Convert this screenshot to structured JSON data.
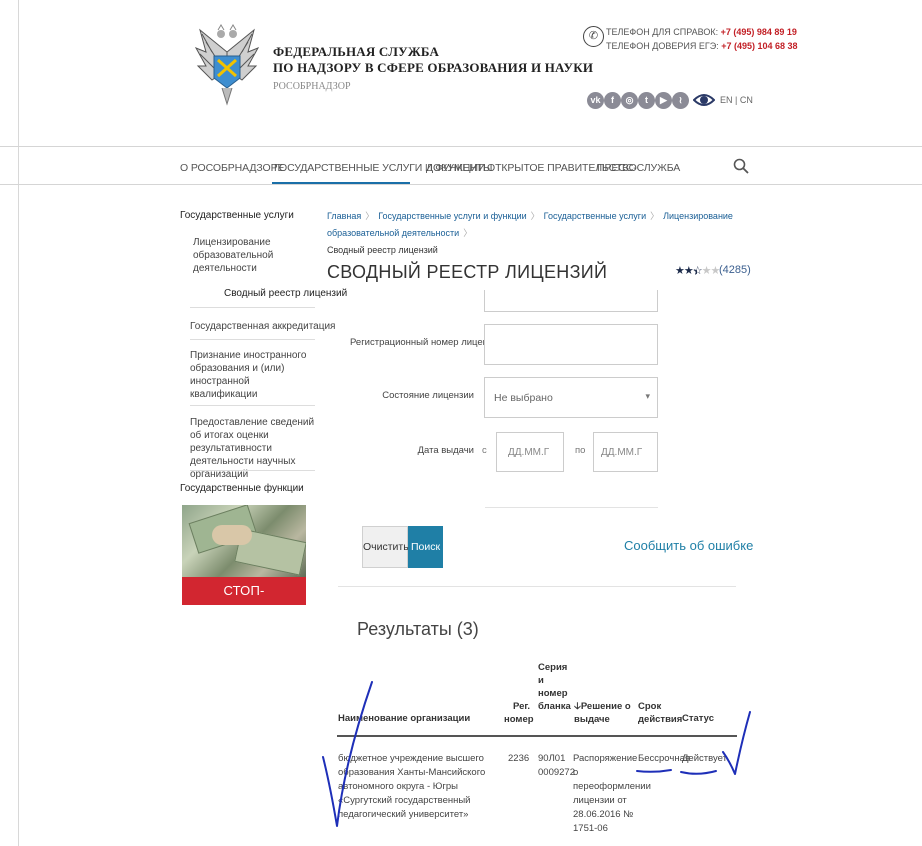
{
  "header": {
    "org_line1": "ФЕДЕРАЛЬНАЯ СЛУЖБА",
    "org_line2": "ПО НАДЗОРУ В СФЕРЕ ОБРАЗОВАНИЯ И НАУКИ",
    "org_short": "РОСОБРНАДЗОР",
    "phone_label": "ТЕЛЕФОН ДЛЯ СПРАВОК:",
    "phone_number": "+7 (495) 984 89 19",
    "trust_label": "ТЕЛЕФОН ДОВЕРИЯ ЕГЭ:",
    "trust_number": "+7 (495) 104 68 38",
    "social_icons": [
      "vk-icon",
      "facebook-icon",
      "instagram-icon",
      "twitter-icon",
      "youtube-icon",
      "rss-icon"
    ],
    "lang_switch": "EN | CN"
  },
  "nav": {
    "items": [
      "О РОСОБРНАДЗОРЕ",
      "ГОСУДАРСТВЕННЫЕ УСЛУГИ И ФУНКЦИИ",
      "ДОКУМЕНТЫ",
      "ОТКРЫТОЕ ПРАВИТЕЛЬСТВО",
      "ПРЕСС-СЛУЖБА"
    ]
  },
  "sidebar": {
    "head1": "Государственные услуги",
    "items": [
      "Лицензирование образовательной деятельности",
      "Сводный реестр лицензий",
      "Государственная аккредитация",
      "Признание иностранного образования и (или) иностранной квалификации",
      "Предоставление сведений об итогах оценки результативности деятельности научных организаций"
    ],
    "head2": "Государственные функции",
    "banner": "СТОП-КОРРУПЦИЯ!"
  },
  "breadcrumbs": [
    "Главная",
    "Государственные услуги и функции",
    "Государственные услуги",
    "Лицензирование образовательной деятельности",
    "Сводный реестр лицензий"
  ],
  "page_title": "СВОДНЫЙ РЕЕСТР ЛИЦЕНЗИЙ",
  "rating": {
    "stars": 2.5,
    "count": "(4285)"
  },
  "form": {
    "reg_label": "Регистрационный номер лицензии",
    "reg_value": "",
    "status_label": "Состояние лицензии",
    "status_value": "Не выбрано",
    "date_label": "Дата выдачи",
    "from_label": "с",
    "to_label": "по",
    "date_placeholder": "ДД.ММ.Г",
    "clear_btn": "Очистить",
    "search_btn": "Поиск",
    "report_link": "Сообщить об ошибке"
  },
  "results": {
    "title": "Результаты (3)",
    "columns": [
      "Наименование организации",
      "Рег. номер",
      "Серия и номер бланка",
      "Решение о выдаче",
      "Срок действия",
      "Статус"
    ],
    "sort_arrow": "🡣",
    "rows": [
      {
        "org": "бюджетное учреждение высшего образования Ханты-Мансийского автономного округа - Югры «Сургутский государственный педагогический университет»",
        "reg": "2236",
        "series": "90Л01 0009272",
        "decision": "Распоряжение о переоформлении лицензии от 28.06.2016 № 1751-06",
        "term": "Бессрочная",
        "status": "Действует"
      }
    ]
  }
}
